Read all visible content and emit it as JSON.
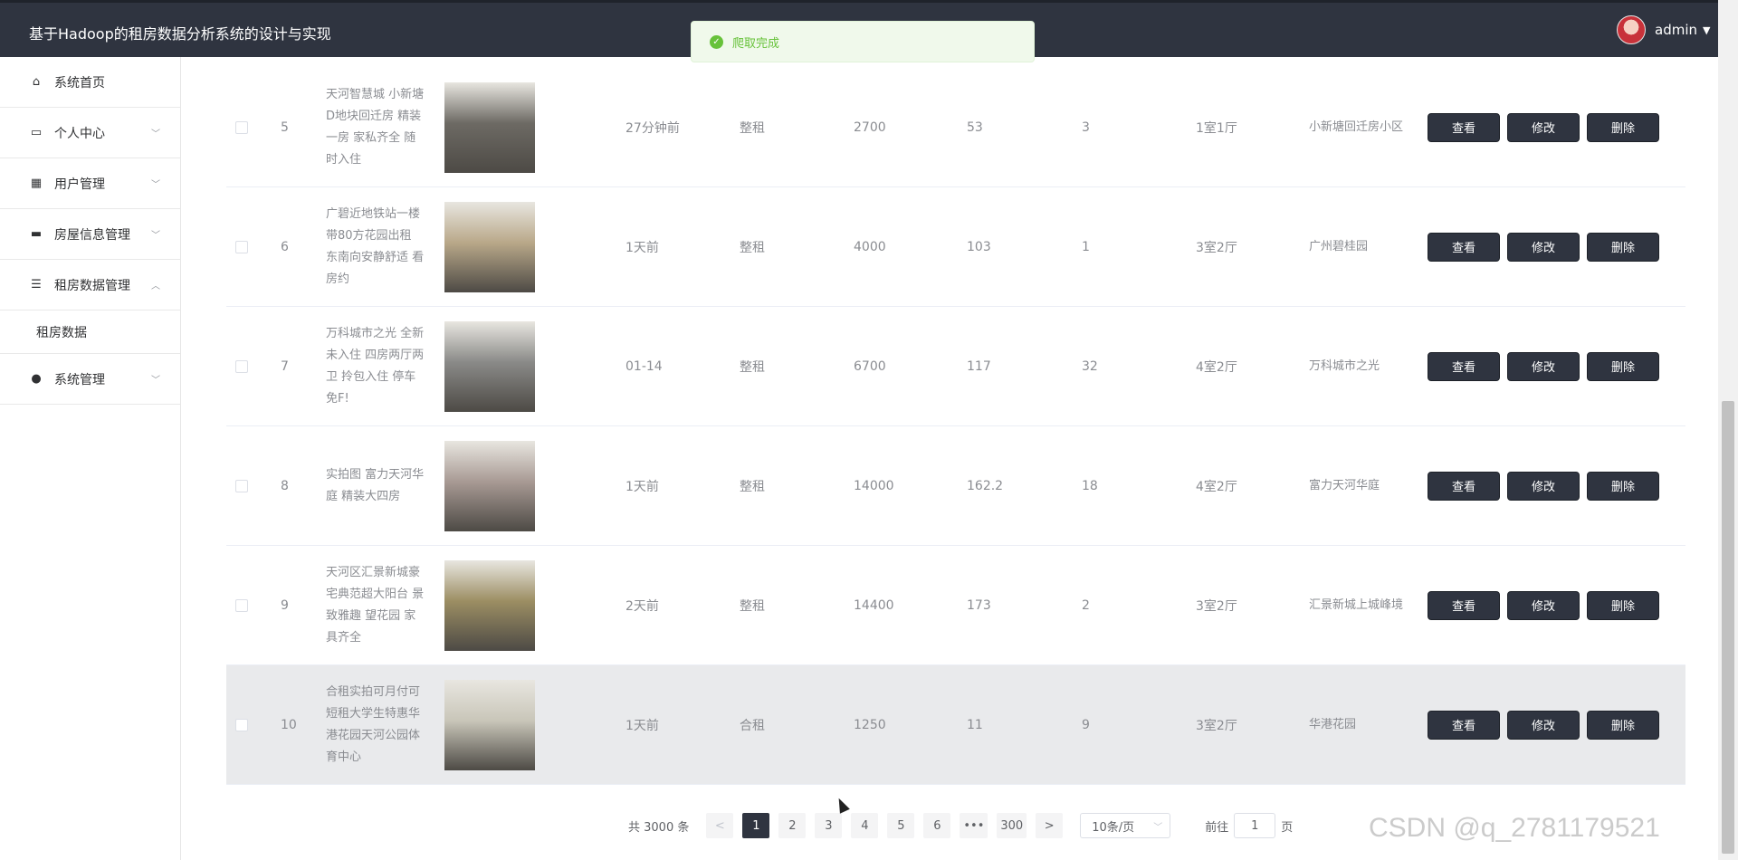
{
  "app": {
    "title": "基于Hadoop的租房数据分析系统的设计与实现",
    "user": "admin"
  },
  "toast": {
    "message": "爬取完成"
  },
  "sidebar": {
    "items": [
      {
        "label": "系统首页",
        "icon": "home-icon",
        "has_arrow": false
      },
      {
        "label": "个人中心",
        "icon": "card-icon",
        "has_arrow": true
      },
      {
        "label": "用户管理",
        "icon": "grid-icon",
        "has_arrow": true
      },
      {
        "label": "房屋信息管理",
        "icon": "monitor-icon",
        "has_arrow": true
      },
      {
        "label": "租房数据管理",
        "icon": "sliders-icon",
        "has_arrow": true,
        "expanded": true
      }
    ],
    "sub_item": "租房数据",
    "last_item": {
      "label": "系统管理",
      "icon": "bulb-icon"
    }
  },
  "ops": {
    "view": "查看",
    "edit": "修改",
    "delete": "删除"
  },
  "rows": [
    {
      "no": "5",
      "title": "天河智慧城 小新塘D地块回迁房 精装一房 家私齐全 随时入住",
      "published": "27分钟前",
      "type": "整租",
      "price": "2700",
      "area": "53",
      "floor": "3",
      "layout": "1室1厅",
      "community": "小新塘回迁房小区",
      "img_color": "#6d6a64"
    },
    {
      "no": "6",
      "title": "广碧近地铁站一楼带80方花园出租 东南向安静舒适 看房约",
      "published": "1天前",
      "type": "整租",
      "price": "4000",
      "area": "103",
      "floor": "1",
      "layout": "3室2厅",
      "community": "广州碧桂园",
      "img_color": "#b9a889"
    },
    {
      "no": "7",
      "title": "万科城市之光 全新未入住 四房两厅两卫 拎包入住 停车免F!",
      "published": "01-14",
      "type": "整租",
      "price": "6700",
      "area": "117",
      "floor": "32",
      "layout": "4室2厅",
      "community": "万科城市之光",
      "img_color": "#8a8a88"
    },
    {
      "no": "8",
      "title": "实拍图 富力天河华庭 精装大四房",
      "published": "1天前",
      "type": "整租",
      "price": "14000",
      "area": "162.2",
      "floor": "18",
      "layout": "4室2厅",
      "community": "富力天河华庭",
      "img_color": "#a89a94"
    },
    {
      "no": "9",
      "title": "天河区汇景新城豪宅典范超大阳台 景致雅趣 望花园 家具齐全",
      "published": "2天前",
      "type": "整租",
      "price": "14400",
      "area": "173",
      "floor": "2",
      "layout": "3室2厅",
      "community": "汇景新城上城峰境",
      "img_color": "#9c8e63"
    },
    {
      "no": "10",
      "title": "合租实拍可月付可短租大学生特惠华港花园天河公园体育中心",
      "published": "1天前",
      "type": "合租",
      "price": "1250",
      "area": "11",
      "floor": "9",
      "layout": "3室2厅",
      "community": "华港花园",
      "img_color": "#c9c6b9"
    }
  ],
  "pagination": {
    "total": "共 3000 条",
    "prev": "<",
    "next": ">",
    "pages": [
      "1",
      "2",
      "3",
      "4",
      "5",
      "6",
      "•••",
      "300"
    ],
    "current": "1",
    "page_size": "10条/页",
    "goto_label": "前往",
    "goto_value": "1",
    "goto_suffix": "页"
  },
  "watermark": "CSDN @q_2781179521"
}
